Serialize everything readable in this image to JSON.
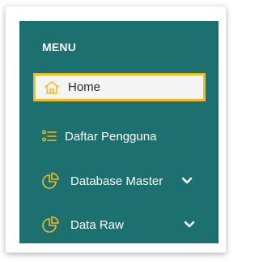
{
  "menu": {
    "title": "MENU",
    "items": [
      {
        "label": "Home",
        "icon": "home-icon",
        "active": true
      },
      {
        "label": "Daftar Pengguna",
        "icon": "list-icon"
      },
      {
        "label": "Database Master",
        "icon": "pie-chart-icon",
        "has_submenu": true
      },
      {
        "label": "Data Raw",
        "icon": "pie-chart-icon",
        "has_submenu": true
      }
    ]
  },
  "colors": {
    "sidebar_bg": "#1d7070",
    "accent": "#f2bd1c",
    "active_bg": "#f4f4f4",
    "text_light": "#ffffff"
  }
}
